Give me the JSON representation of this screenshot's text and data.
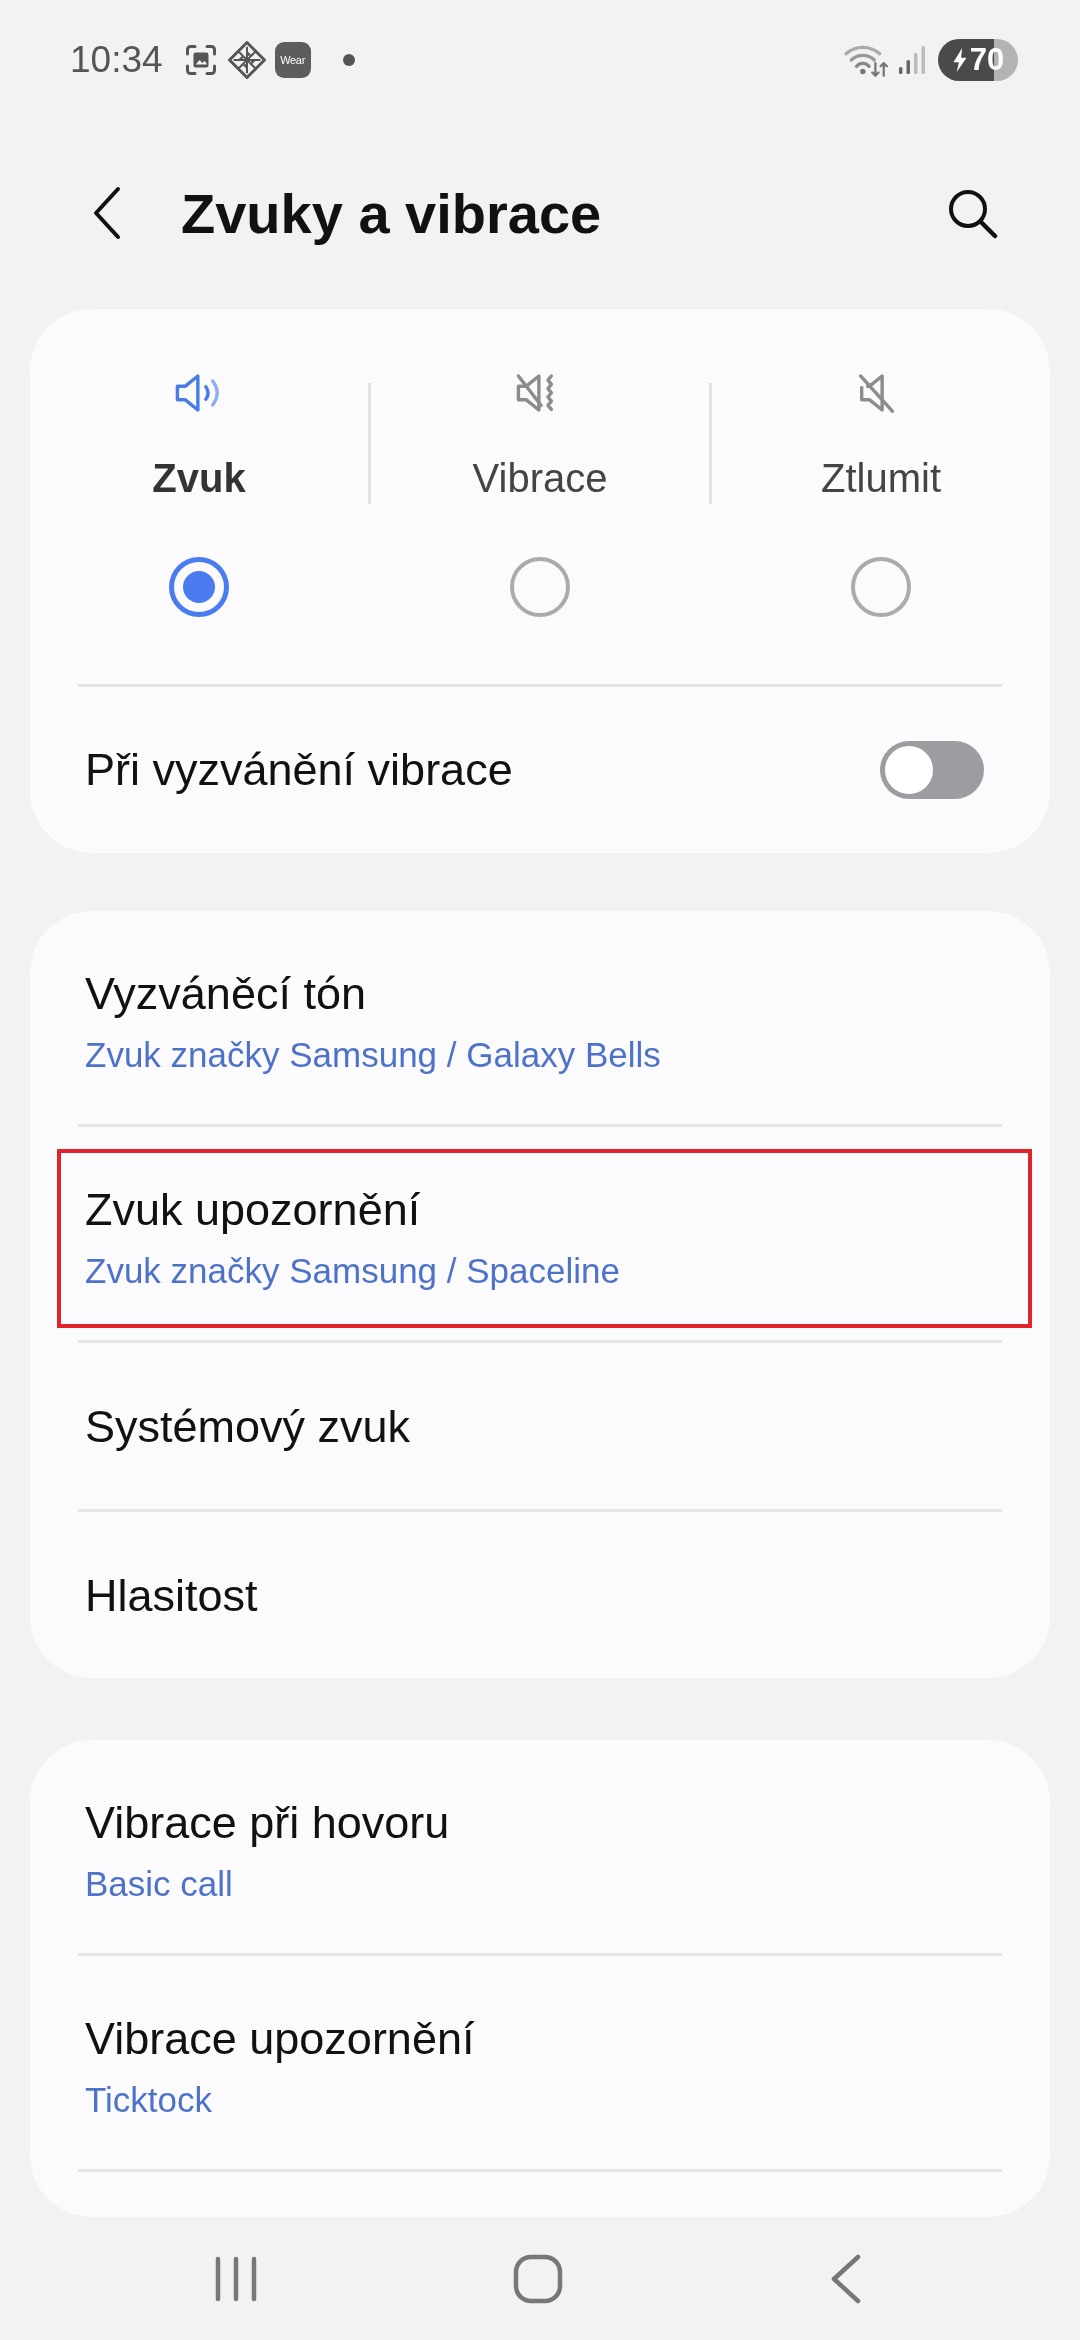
{
  "status_bar": {
    "time": "10:34",
    "app_badge": "Wear",
    "battery": "70"
  },
  "header": {
    "title": "Zvuky a vibrace"
  },
  "sound_modes": [
    {
      "label": "Zvuk",
      "kind": "sound",
      "selected": true
    },
    {
      "label": "Vibrace",
      "kind": "vibrate",
      "selected": false
    },
    {
      "label": "Ztlumit",
      "kind": "mute",
      "selected": false
    }
  ],
  "ring_vibrate": {
    "label": "Při vyzvánění vibrace",
    "on": false
  },
  "sections": [
    {
      "items": [
        {
          "title": "Vyzváněcí tón",
          "subtitle": "Zvuk značky Samsung / Galaxy Bells",
          "highlighted": false
        },
        {
          "title": "Zvuk upozornění",
          "subtitle": "Zvuk značky Samsung / Spaceline",
          "highlighted": true
        },
        {
          "title": "Systémový zvuk",
          "highlighted": false
        },
        {
          "title": "Hlasitost",
          "highlighted": false
        }
      ]
    },
    {
      "items": [
        {
          "title": "Vibrace při hovoru",
          "subtitle": "Basic call",
          "highlighted": false
        },
        {
          "title": "Vibrace upozornění",
          "subtitle": "Ticktock",
          "highlighted": false
        }
      ]
    }
  ]
}
